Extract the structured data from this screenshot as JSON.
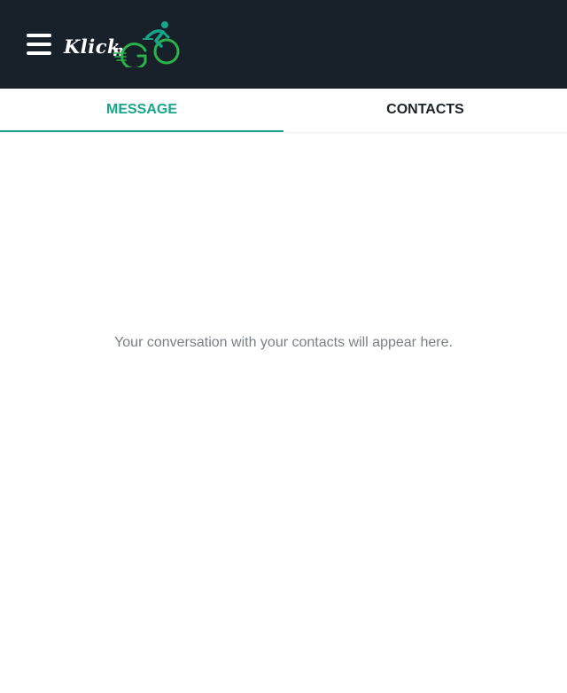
{
  "header": {
    "menu_icon": "hamburger-menu-icon",
    "logo": {
      "text_main": "Klick",
      "text_n": "n",
      "text_go": "GO",
      "icon": "cyclist-logo-icon",
      "accent_color": "#2bb34a",
      "rider_color": "#17a689"
    },
    "background": "#18202a"
  },
  "tabs": [
    {
      "label": "MESSAGE",
      "active": true
    },
    {
      "label": "CONTACTS",
      "active": false
    }
  ],
  "accent_color": "#17a689",
  "main": {
    "empty_message": "Your conversation with your contacts will appear here."
  }
}
